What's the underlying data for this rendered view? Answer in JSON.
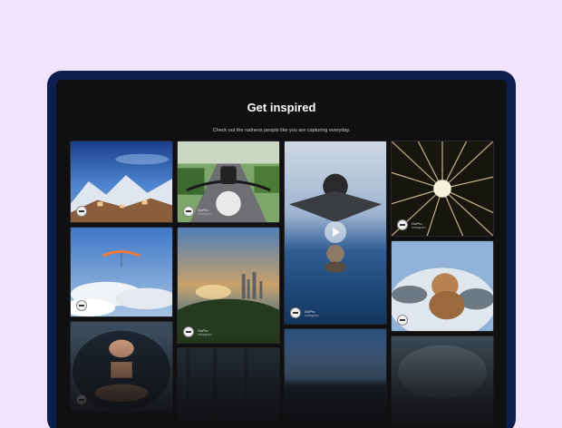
{
  "header": {
    "title": "Get inspired",
    "subtitle": "Check out the radness people like you are capturing everyday."
  },
  "tiles": [
    {
      "id": "village",
      "credit": null
    },
    {
      "id": "motorcycle",
      "credit": {
        "name": "GoPro",
        "source": "Instagram"
      }
    },
    {
      "id": "skydiver",
      "credit": {
        "name": "GoPro",
        "source": "Instagram"
      },
      "video": true
    },
    {
      "id": "forest-canopy",
      "credit": {
        "name": "GoPro",
        "source": "Instagram"
      }
    },
    {
      "id": "paraglider",
      "credit": null
    },
    {
      "id": "city-sunset",
      "credit": {
        "name": "GoPro",
        "source": "Instagram"
      }
    },
    {
      "id": "dog-mountain",
      "credit": null
    },
    {
      "id": "hands-fisheye",
      "credit": null
    },
    {
      "id": "dark-forest",
      "credit": null
    },
    {
      "id": "dusk-lake",
      "credit": null
    },
    {
      "id": "foggy-road",
      "credit": null
    }
  ],
  "icons": {
    "play": "play-icon",
    "avatar": "gopro-avatar-icon"
  },
  "colors": {
    "background": "#f0e3fb",
    "device": "#0d1f4f",
    "screen": "#101012"
  }
}
